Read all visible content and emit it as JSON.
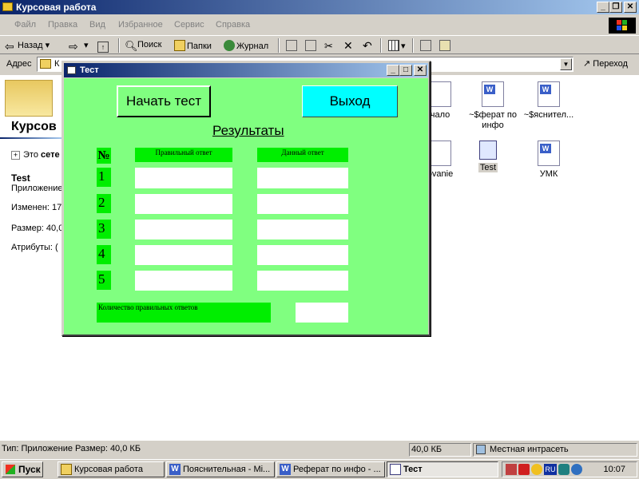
{
  "window": {
    "title": "Курсовая работа",
    "controls": {
      "minimize": "_",
      "restore": "❐",
      "close": "✕"
    }
  },
  "menu": [
    "Файл",
    "Правка",
    "Вид",
    "Избранное",
    "Сервис",
    "Справка"
  ],
  "toolbar": {
    "back": "Назад",
    "search": "Поиск",
    "folders": "Папки",
    "history": "Журнал"
  },
  "address": {
    "label": "Адрес",
    "value": "К",
    "go": "Переход"
  },
  "left_pane": {
    "title": "Курсов",
    "network_label": "Это ",
    "network_bold": "сете",
    "item_name": "Test",
    "item_type": "Приложение",
    "modified": "Изменен: 17",
    "size": "Размер: 40,0",
    "attributes": "Атрибуты: ("
  },
  "files": [
    {
      "name": "чало",
      "icon": "doc"
    },
    {
      "name": "~$ферат по инфо",
      "icon": "word"
    },
    {
      "name": "~$яснител...",
      "icon": "word"
    },
    {
      "name": "ovanie",
      "icon": "doc"
    },
    {
      "name": "Test",
      "icon": "exe"
    },
    {
      "name": "УМК",
      "icon": "word"
    }
  ],
  "status": {
    "text": "Тип: Приложение Размер: 40,0 КБ",
    "size": "40,0 КБ",
    "zone": "Местная интрасеть"
  },
  "taskbar": {
    "start": "Пуск",
    "tasks": [
      {
        "label": "Курсовая работа",
        "active": false
      },
      {
        "label": "Пояснительная - Mi...",
        "active": false
      },
      {
        "label": "Реферат по инфо - ...",
        "active": false
      },
      {
        "label": "Тест",
        "active": true
      }
    ],
    "lang": "RU",
    "clock": "10:07"
  },
  "dialog": {
    "title": "Тест",
    "controls": {
      "minimize": "_",
      "maximize": "□",
      "close": "✕"
    },
    "start_button": "Начать тест",
    "exit_button": "Выход",
    "results_title": "Результаты",
    "col_number": "№",
    "col_correct": "Правильный ответ",
    "col_given": "Данный ответ",
    "rows": [
      "1",
      "2",
      "3",
      "4",
      "5"
    ],
    "count_label": "Количество правильных ответов"
  },
  "colors": {
    "dialog_bg": "#80ff80",
    "label_bg": "#00ee00",
    "exit_bg": "#00ffff",
    "titlebar": "#0a246a"
  }
}
